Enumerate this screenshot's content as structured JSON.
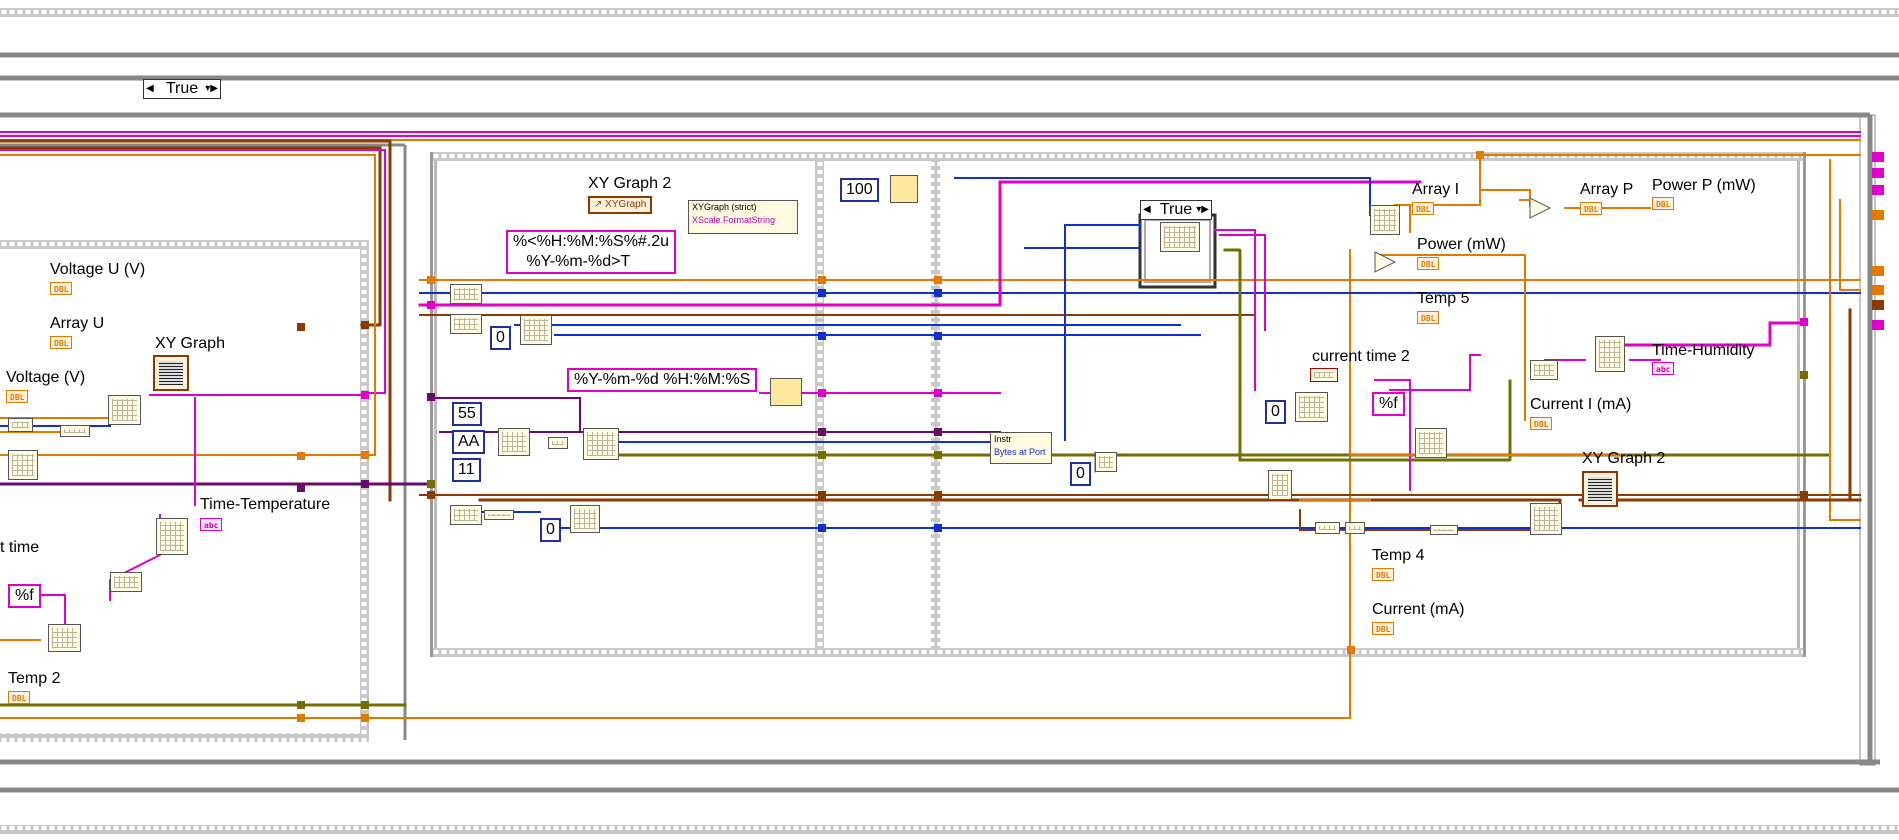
{
  "case_selectors": {
    "outer": "True",
    "inner": "True"
  },
  "labels": {
    "voltage_u": "Voltage U (V)",
    "array_u": "Array U",
    "voltage_v": "Voltage (V)",
    "xy_graph": "XY Graph",
    "time_temperature": "Time-Temperature",
    "t_time": "t time",
    "temp_2": "Temp 2",
    "xy_graph_2_top": "XY Graph 2",
    "array_i": "Array I",
    "array_p": "Array P",
    "power_p": "Power P (mW)",
    "power_mw": "Power (mW)",
    "temp_5": "Temp 5",
    "current_time_2": "current time 2",
    "time_humidity": "Time-Humidity",
    "current_i": "Current I (mA)",
    "xy_graph_2_bottom": "XY Graph 2",
    "temp_4": "Temp 4",
    "current_ma": "Current (mA)"
  },
  "terminals": {
    "dbl": "DBL",
    "str": "abc"
  },
  "constants": {
    "format_f_left": "%f",
    "format_f_right": "%f",
    "timestamp_format": "%<%H:%M:%S%#.2u\n   %Y-%m-%d>T",
    "date_format": "%Y-%m-%d %H:%M:%S",
    "wait_ms": "100",
    "zero_a": "0",
    "zero_b": "0",
    "zero_c": "0",
    "zero_d": "0",
    "hex_55": "55",
    "hex_aa": "AA",
    "hex_11": "11"
  },
  "property_nodes": {
    "xygraph_ref": "XYGraph",
    "xygraph_strict": "XYGraph (strict)",
    "xscale_format": "XScale.FormatString",
    "instr": "Instr",
    "bytes_at_port": "Bytes at Port"
  },
  "colors": {
    "wire_orange": "#e07b00",
    "wire_pink": "#e000c8",
    "wire_blue": "#1030d0",
    "wire_brown": "#8b3a00",
    "wire_purple": "#6a0a6a",
    "wire_olive": "#707000"
  }
}
